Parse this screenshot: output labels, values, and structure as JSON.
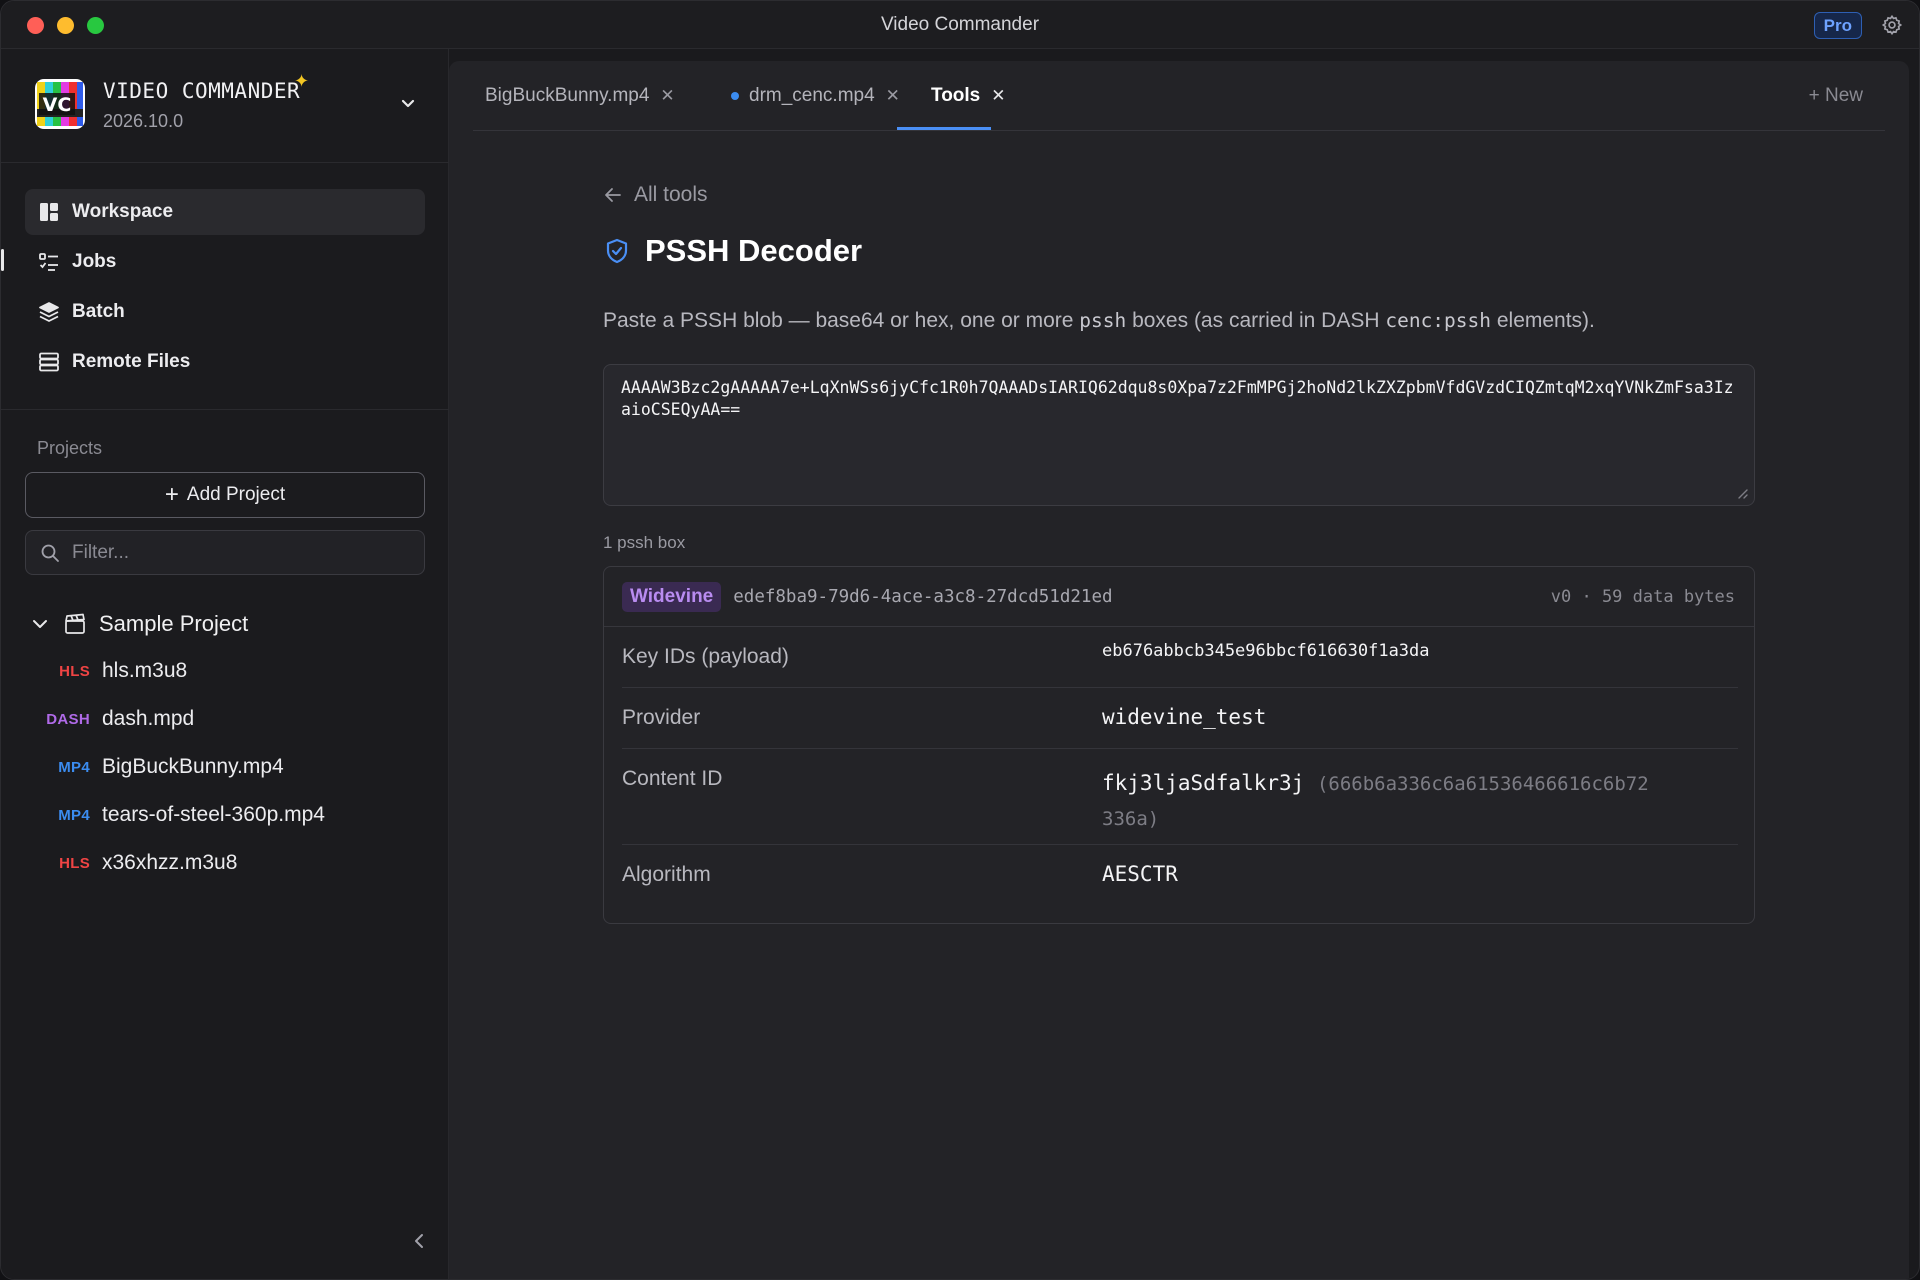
{
  "window": {
    "title": "Video Commander",
    "pro_label": "Pro"
  },
  "app": {
    "name": "VIDEO COMMANDER",
    "version": "2026.10.0",
    "logo_text": "VC"
  },
  "nav": [
    {
      "label": "Workspace",
      "icon": "workspace-icon",
      "active": true
    },
    {
      "label": "Jobs",
      "icon": "jobs-icon"
    },
    {
      "label": "Batch",
      "icon": "batch-icon"
    },
    {
      "label": "Remote Files",
      "icon": "server-icon"
    }
  ],
  "projects": {
    "label": "Projects",
    "add_label": "Add Project",
    "filter_placeholder": "Filter...",
    "root": {
      "name": "Sample Project",
      "expanded": true,
      "files": [
        {
          "type": "HLS",
          "name": "hls.m3u8",
          "color": "#ef4444"
        },
        {
          "type": "DASH",
          "name": "dash.mpd",
          "color": "#b06ae8"
        },
        {
          "type": "MP4",
          "name": "BigBuckBunny.mp4",
          "color": "#3b8cf0"
        },
        {
          "type": "MP4",
          "name": "tears-of-steel-360p.mp4",
          "color": "#3b8cf0"
        },
        {
          "type": "HLS",
          "name": "x36xhzz.m3u8",
          "color": "#ef4444"
        }
      ]
    }
  },
  "tabs": [
    {
      "label": "BigBuckBunny.mp4",
      "modified": false
    },
    {
      "label": "drm_cenc.mp4",
      "modified": true
    },
    {
      "label": "Tools",
      "active": true
    }
  ],
  "new_tab_label": "+ New",
  "tool": {
    "back_label": "All tools",
    "title": "PSSH Decoder",
    "desc_1": "Paste a PSSH blob — base64 or hex, one or more ",
    "desc_code_1": "pssh",
    "desc_2": " boxes (as carried in DASH ",
    "desc_code_2": "cenc:pssh",
    "desc_3": " elements).",
    "input_value": "AAAAW3Bzc2gAAAAA7e+LqXnWSs6jyCfc1R0h7QAAADsIARIQ62dqu8s0Xpa7z2FmMPGj2hoNd2lkZXZpbmVfdGVzdCIQZmtqM2xqYVNkZmFsa3IzaioCSEQyAA==",
    "box_count": "1 pssh box"
  },
  "result": {
    "system": "Widevine",
    "system_id": "edef8ba9-79d6-4ace-a3c8-27dcd51d21ed",
    "meta": "v0 · 59 data bytes",
    "rows": [
      {
        "key": "Key IDs (payload)",
        "value": "eb676abbcb345e96bbcf616630f1a3da"
      },
      {
        "key": "Provider",
        "value": "widevine_test"
      },
      {
        "key": "Content ID",
        "value": "fkj3ljaSdfalkr3j",
        "hex_line1": "(666b6a336c6a61536466616c6b72",
        "hex_line2": "336a)"
      },
      {
        "key": "Algorithm",
        "value": "AESCTR"
      }
    ]
  }
}
